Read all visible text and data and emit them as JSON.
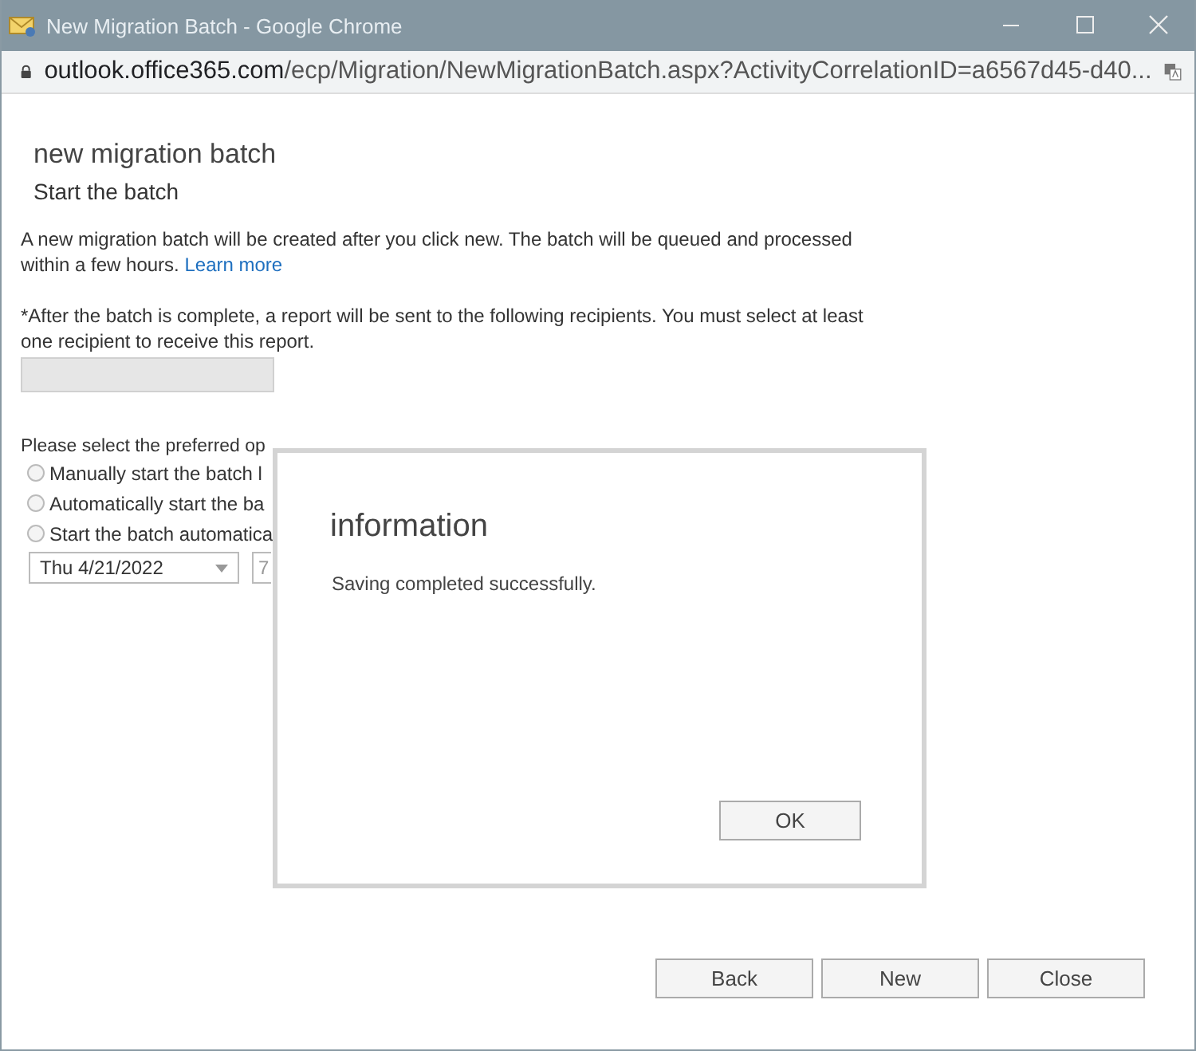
{
  "window": {
    "title": "New Migration Batch - Google Chrome"
  },
  "address_bar": {
    "domain": "outlook.office365.com",
    "path": "/ecp/Migration/NewMigrationBatch.aspx?ActivityCorrelationID=a6567d45-d40..."
  },
  "page": {
    "title": "new migration batch",
    "subtitle": "Start the batch",
    "intro": "A new migration batch will be created after you click new. The batch will be queued and processed within a few hours.",
    "learn_more": "Learn more",
    "recipients_label": "*After the batch is complete, a report will be sent to the following recipients. You must select at least one recipient to receive this report.",
    "recipients_field": {
      "disabled": true
    },
    "options_label": "Please select the preferred op",
    "options": [
      {
        "label": "Manually start the batch l",
        "selected": false
      },
      {
        "label": "Automatically start the ba",
        "selected": false
      },
      {
        "label": "Start the batch automatica",
        "selected": false
      }
    ],
    "date_field": {
      "value": "Thu 4/21/2022"
    },
    "time_field": {
      "value": "7"
    }
  },
  "buttons": [
    "Back",
    "New",
    "Close"
  ],
  "dialog": {
    "title": "information",
    "message": "Saving completed successfully.",
    "button": "OK"
  }
}
